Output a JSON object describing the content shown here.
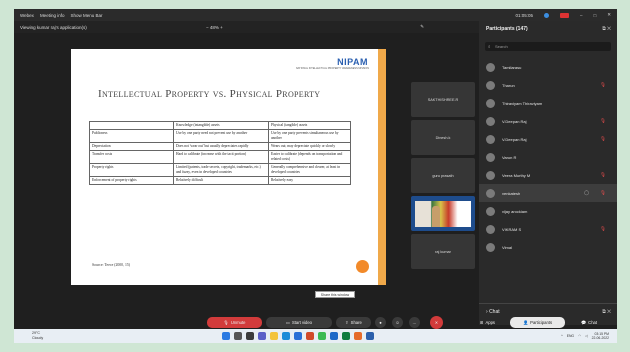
{
  "topbar": {
    "app": "Webex",
    "meeting_info": "Meeting info",
    "menu_bar": "Show Menu Bar",
    "timer": "01:05:05"
  },
  "viewbar": {
    "viewing": "Viewing kumar raj's application(s)",
    "zoom": "48%"
  },
  "slide": {
    "logo": "NIPAM",
    "logo_sub": "NATIONAL INTELLECTUAL PROPERTY AWARENESS MISSION",
    "title": "Intellectual Property vs. Physical Property",
    "header": [
      "",
      "Knowledge (intangible) assets",
      "Physical (tangible) assets"
    ],
    "rows": [
      [
        "Publicness",
        "Use by one party need not prevent use by another",
        "Use by one party prevents simultaneous use by another"
      ],
      [
        "Depreciation",
        "Does not 'wear out' but usually depreciates rapidly",
        "Wears out; may depreciate quickly or slowly"
      ],
      [
        "Transfer costs",
        "Hard to calibrate (increase with the tacit portion)",
        "Easier to calibrate (depends on transportation and related costs)"
      ],
      [
        "Property rights",
        "Limited (patents, trade secrets, copyright, trademarks, etc.) and fuzzy, even in developed countries",
        "Generally comprehensive and clearer, at least in developed countries"
      ],
      [
        "Enforcement of property rights",
        "Relatively difficult",
        "Relatively easy"
      ]
    ],
    "source": "Source: Teece (2000, 15)"
  },
  "tooltip": "Share this window",
  "tiles": [
    "SAKTHISHREE.R",
    "Dinesh.k",
    "guru prasath",
    "",
    "raj kumar"
  ],
  "panel": {
    "title": "Participants (147)",
    "search_placeholder": "Search",
    "participants": [
      {
        "name": "Tamilarasu",
        "muted": false
      },
      {
        "name": "Tharun",
        "muted": true
      },
      {
        "name": "Thiraviyam Thiraviyam",
        "muted": false
      },
      {
        "name": "V.Deepan Raj",
        "muted": true
      },
      {
        "name": "V.Deepan Raj",
        "muted": true
      },
      {
        "name": "Varun R",
        "muted": false
      },
      {
        "name": "Veera Murthy M",
        "muted": true
      },
      {
        "name": "venkatesh",
        "muted": true
      },
      {
        "name": "vijay arockiam",
        "muted": false
      },
      {
        "name": "VIKRAM S",
        "muted": true
      },
      {
        "name": "Vimal",
        "muted": false
      }
    ],
    "chat_title": "Chat"
  },
  "controls": {
    "unmute": "Unmute",
    "start_video": "Start video",
    "share": "Share",
    "apps": "Apps",
    "participants": "Participants",
    "chat": "Chat"
  },
  "taskbar": {
    "temp": "29°C",
    "weather": "Cloudy",
    "time": "03:15 PM",
    "date": "22-06-2022",
    "lang": "ENG"
  }
}
